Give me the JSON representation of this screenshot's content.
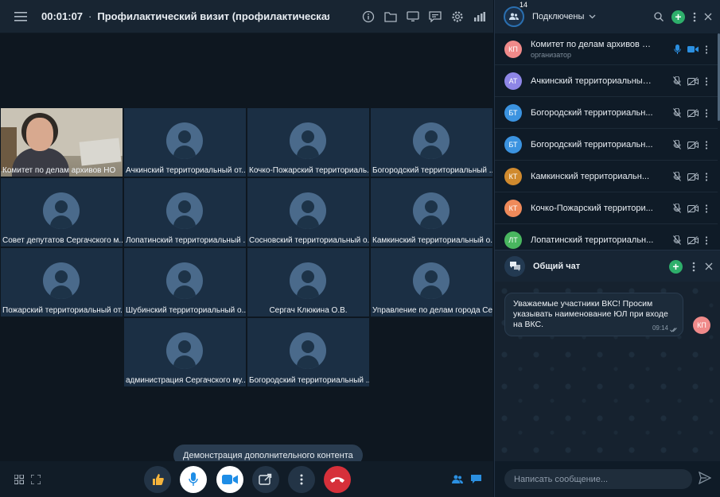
{
  "topbar": {
    "timer": "00:01:07",
    "separator": "·",
    "title": "Профилактический визит (профилактическая бе..."
  },
  "tiles": [
    {
      "name": "Комитет по делам архивов НО",
      "camera": true
    },
    {
      "name": "Ачкинский территориальный от..."
    },
    {
      "name": "Кочко-Пожарский территориаль..."
    },
    {
      "name": "Богородский территориальный ..."
    },
    {
      "name": "Совет депутатов Сергачского м..."
    },
    {
      "name": "Лопатинский территориальный ..."
    },
    {
      "name": "Сосновский территориальный о..."
    },
    {
      "name": "Камкинский территориальный о..."
    },
    {
      "name": "Пожарский территориальный от..."
    },
    {
      "name": "Шубинский территориальный о..."
    },
    {
      "name": "Сергач Клюкина О.В.",
      "center": true
    },
    {
      "name": "Управление по делам города Се..."
    },
    {
      "name": "администрация Сергачского му..."
    },
    {
      "name": "Богородский территориальный ..."
    }
  ],
  "tooltip": "Демонстрация дополнительного контента",
  "participants": {
    "count": "14",
    "label": "Подключены",
    "items": [
      {
        "initials": "КП",
        "name": "Комитет по делам архивов НО",
        "role": "организатор",
        "color": "#f08a8a"
      },
      {
        "initials": "АТ",
        "name": "Ачкинский территориальный ...",
        "color": "#8e86e6"
      },
      {
        "initials": "БТ",
        "name": "Богородский территориальн...",
        "color": "#3b93e0"
      },
      {
        "initials": "БТ",
        "name": "Богородский территориальн...",
        "color": "#3b93e0"
      },
      {
        "initials": "КТ",
        "name": "Камкинский территориальн...",
        "color": "#d08a2e"
      },
      {
        "initials": "КТ",
        "name": "Кочко-Пожарский территори...",
        "color": "#ef8a5a"
      },
      {
        "initials": "ЛТ",
        "name": "Лопатинский территориальн...",
        "color": "#49b65f"
      }
    ]
  },
  "chat": {
    "title": "Общий чат",
    "message": "Уважаемые участники ВКС! Просим указывать наименование ЮЛ при входе на ВКС.",
    "time": "09:14",
    "sender_initials": "КП",
    "placeholder": "Написать сообщение..."
  },
  "colors": {
    "accent": "#2d8fd8",
    "hangup": "#d6303a",
    "add": "#2eaf6b",
    "tile": "#1b2f44"
  }
}
